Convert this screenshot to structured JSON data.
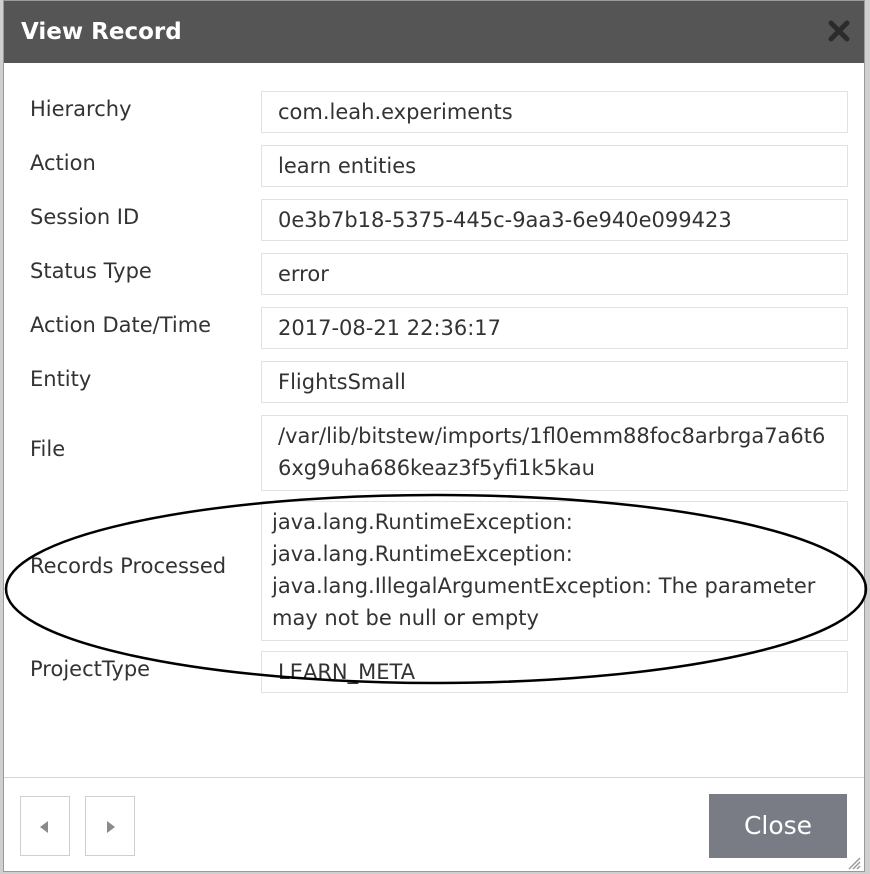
{
  "dialog": {
    "title": "View Record",
    "fields": [
      {
        "label": "Hierarchy",
        "value": "com.leah.experiments"
      },
      {
        "label": "Action",
        "value": "learn entities"
      },
      {
        "label": "Session ID",
        "value": "0e3b7b18-5375-445c-9aa3-6e940e099423"
      },
      {
        "label": "Status Type",
        "value": "error"
      },
      {
        "label": "Action Date/Time",
        "value": "2017-08-21 22:36:17"
      },
      {
        "label": "Entity",
        "value": "FlightsSmall"
      },
      {
        "label": "File",
        "value": "/var/lib/bitstew/imports/1fl0emm88foc8arbrga7a6t66xg9uha686keaz3f5yfi1k5kau"
      },
      {
        "label": "Records Processed",
        "value": " java.lang.RuntimeException: java.lang.RuntimeException: java.lang.IllegalArgumentException: The parameter may not be null or empty"
      },
      {
        "label": "ProjectType",
        "value": "LEARN_META"
      }
    ],
    "close_label": "Close"
  },
  "colors": {
    "titlebar": "#555555",
    "close_button": "#7a7c85",
    "annotation": "#000000"
  },
  "icons": {
    "title_close": "close-icon",
    "prev": "chevron-left-icon",
    "next": "chevron-right-icon",
    "resize": "resize-grip-icon"
  }
}
